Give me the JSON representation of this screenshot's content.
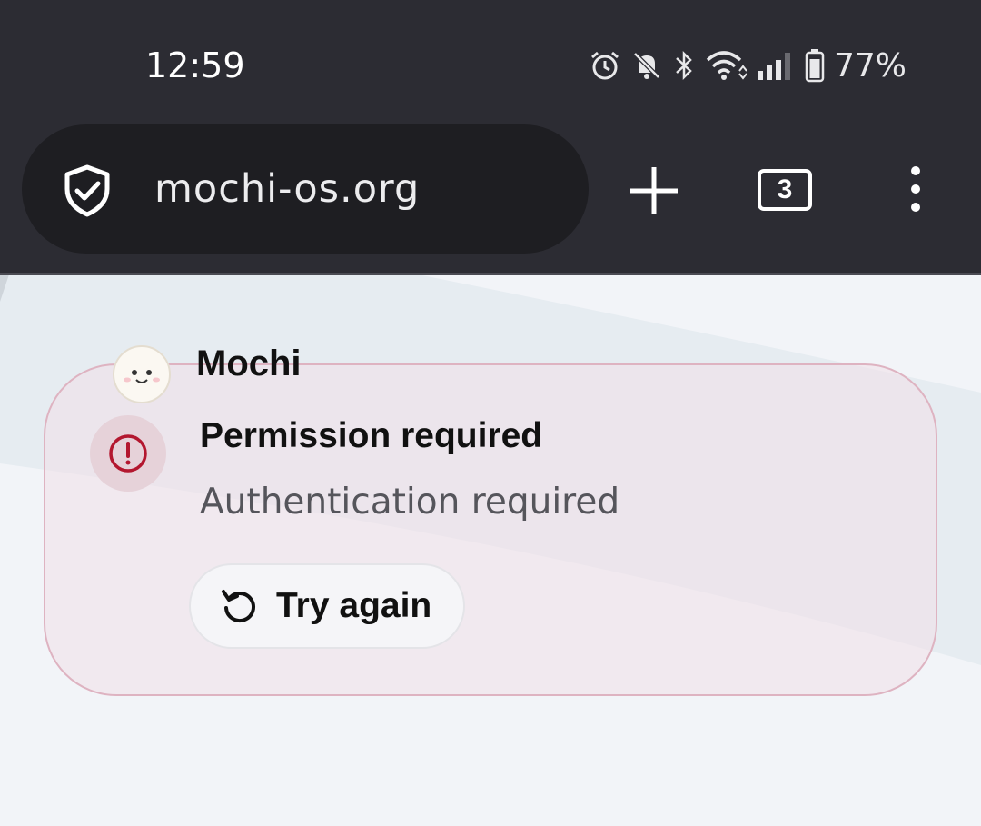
{
  "status_bar": {
    "time": "12:59",
    "battery_percent": "77%",
    "icons": [
      "alarm-icon",
      "bell-off-icon",
      "bluetooth-icon",
      "wifi-icon",
      "signal-icon",
      "battery-icon"
    ]
  },
  "browser": {
    "url": "mochi-os.org",
    "tab_count": "3",
    "icons": [
      "shield-check-icon",
      "plus-icon",
      "tabs-icon",
      "more-vert-icon"
    ]
  },
  "notification": {
    "app_name": "Mochi",
    "title": "Permission required",
    "message": "Authentication required",
    "action_label": "Try again",
    "icons": [
      "mochi-avatar-icon",
      "alert-circle-icon",
      "refresh-icon"
    ]
  },
  "colors": {
    "toolbar_bg": "#2c2c33",
    "url_pill_bg": "#1e1e22",
    "card_border": "#deb3c1",
    "alert_red": "#b3172f"
  }
}
